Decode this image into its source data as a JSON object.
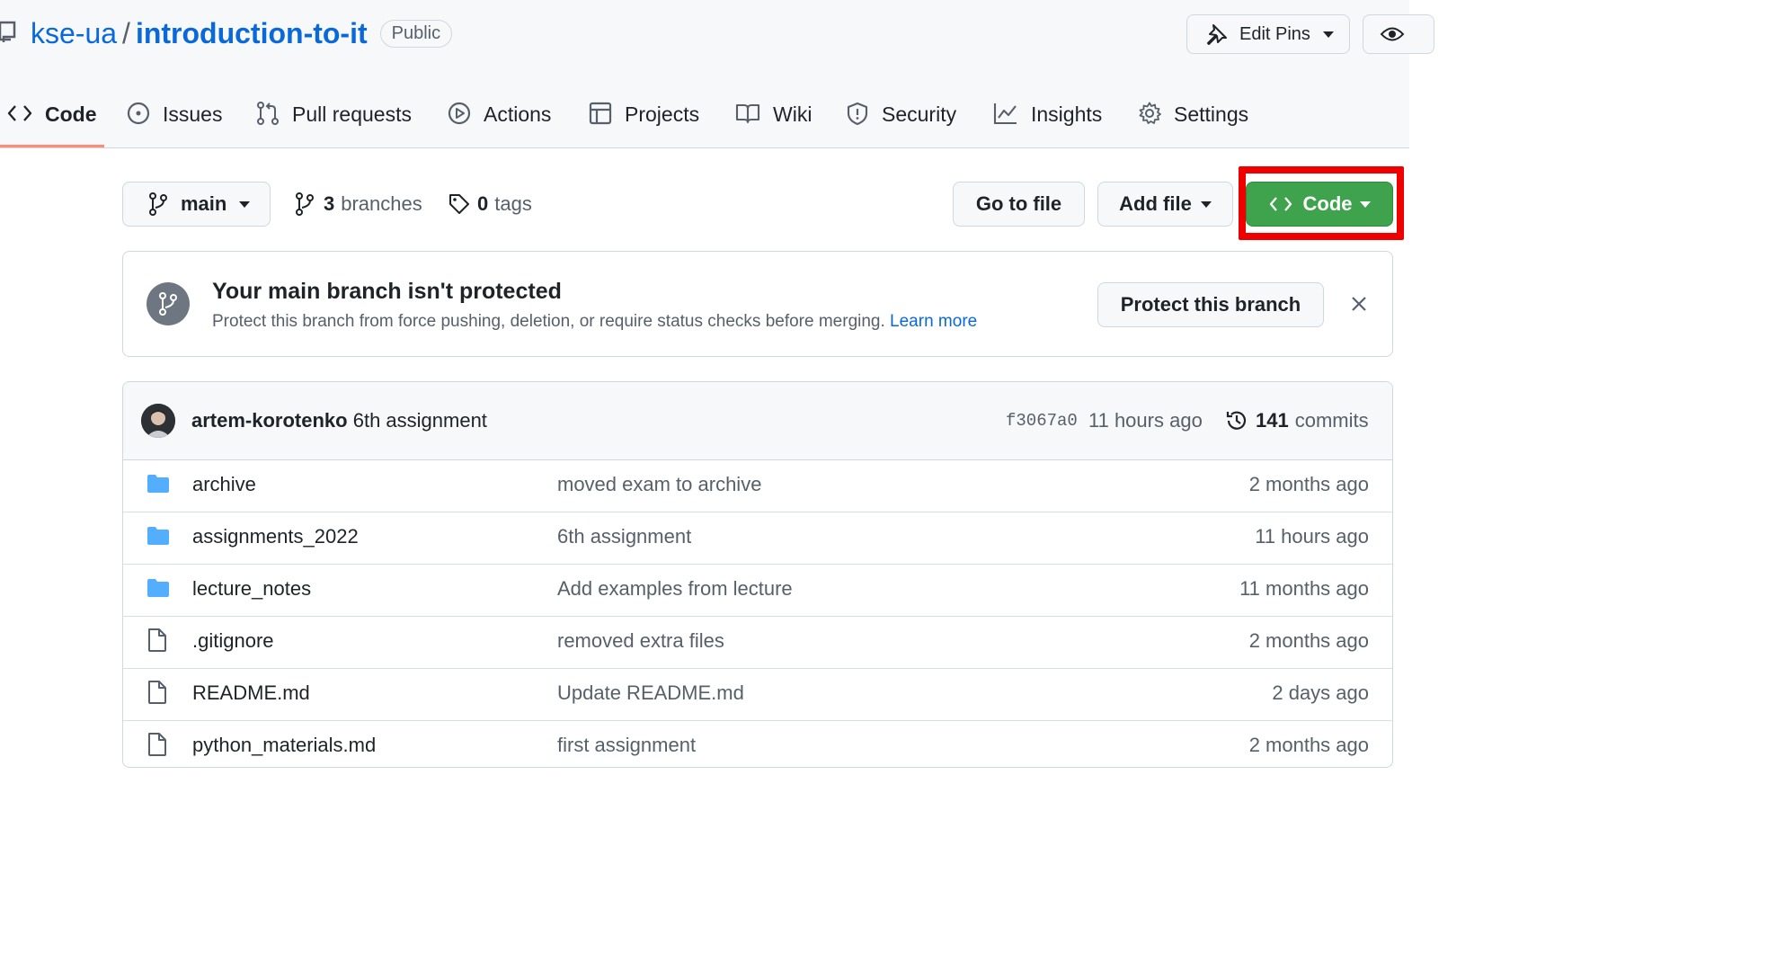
{
  "repo": {
    "owner": "kse-ua",
    "separator": "/",
    "name": "introduction-to-it",
    "visibility": "Public"
  },
  "header_buttons": {
    "edit_pins": "Edit Pins"
  },
  "tabs": [
    {
      "label": "Code",
      "icon": "code-icon",
      "active": true
    },
    {
      "label": "Issues",
      "icon": "issue-icon"
    },
    {
      "label": "Pull requests",
      "icon": "pull-request-icon"
    },
    {
      "label": "Actions",
      "icon": "play-icon"
    },
    {
      "label": "Projects",
      "icon": "table-icon"
    },
    {
      "label": "Wiki",
      "icon": "book-icon"
    },
    {
      "label": "Security",
      "icon": "shield-icon"
    },
    {
      "label": "Insights",
      "icon": "graph-icon"
    },
    {
      "label": "Settings",
      "icon": "gear-icon"
    }
  ],
  "toolbar": {
    "branch": "main",
    "branches_count": "3",
    "branches_label": "branches",
    "tags_count": "0",
    "tags_label": "tags",
    "go_to_file": "Go to file",
    "add_file": "Add file",
    "code_button": "Code"
  },
  "banner": {
    "title": "Your main branch isn't protected",
    "text": "Protect this branch from force pushing, deletion, or require status checks before merging.",
    "link": "Learn more",
    "button": "Protect this branch"
  },
  "latest_commit": {
    "author": "artem-korotenko",
    "message": "6th assignment",
    "sha": "f3067a0",
    "time": "11 hours ago",
    "commits_count": "141",
    "commits_label": "commits"
  },
  "files": [
    {
      "name": "archive",
      "type": "folder",
      "message": "moved exam to archive",
      "age": "2 months ago"
    },
    {
      "name": "assignments_2022",
      "type": "folder",
      "message": "6th assignment",
      "age": "11 hours ago"
    },
    {
      "name": "lecture_notes",
      "type": "folder",
      "message": "Add examples from lecture",
      "age": "11 months ago"
    },
    {
      "name": ".gitignore",
      "type": "file",
      "message": "removed extra files",
      "age": "2 months ago"
    },
    {
      "name": "README.md",
      "type": "file",
      "message": "Update README.md",
      "age": "2 days ago"
    },
    {
      "name": "python_materials.md",
      "type": "file",
      "message": "first assignment",
      "age": "2 months ago"
    }
  ],
  "colors": {
    "accent": "#0969da",
    "green_button": "#3fa34d",
    "highlight": "#ee0000",
    "tab_underline": "#fd8c73",
    "folder": "#54aeff"
  }
}
